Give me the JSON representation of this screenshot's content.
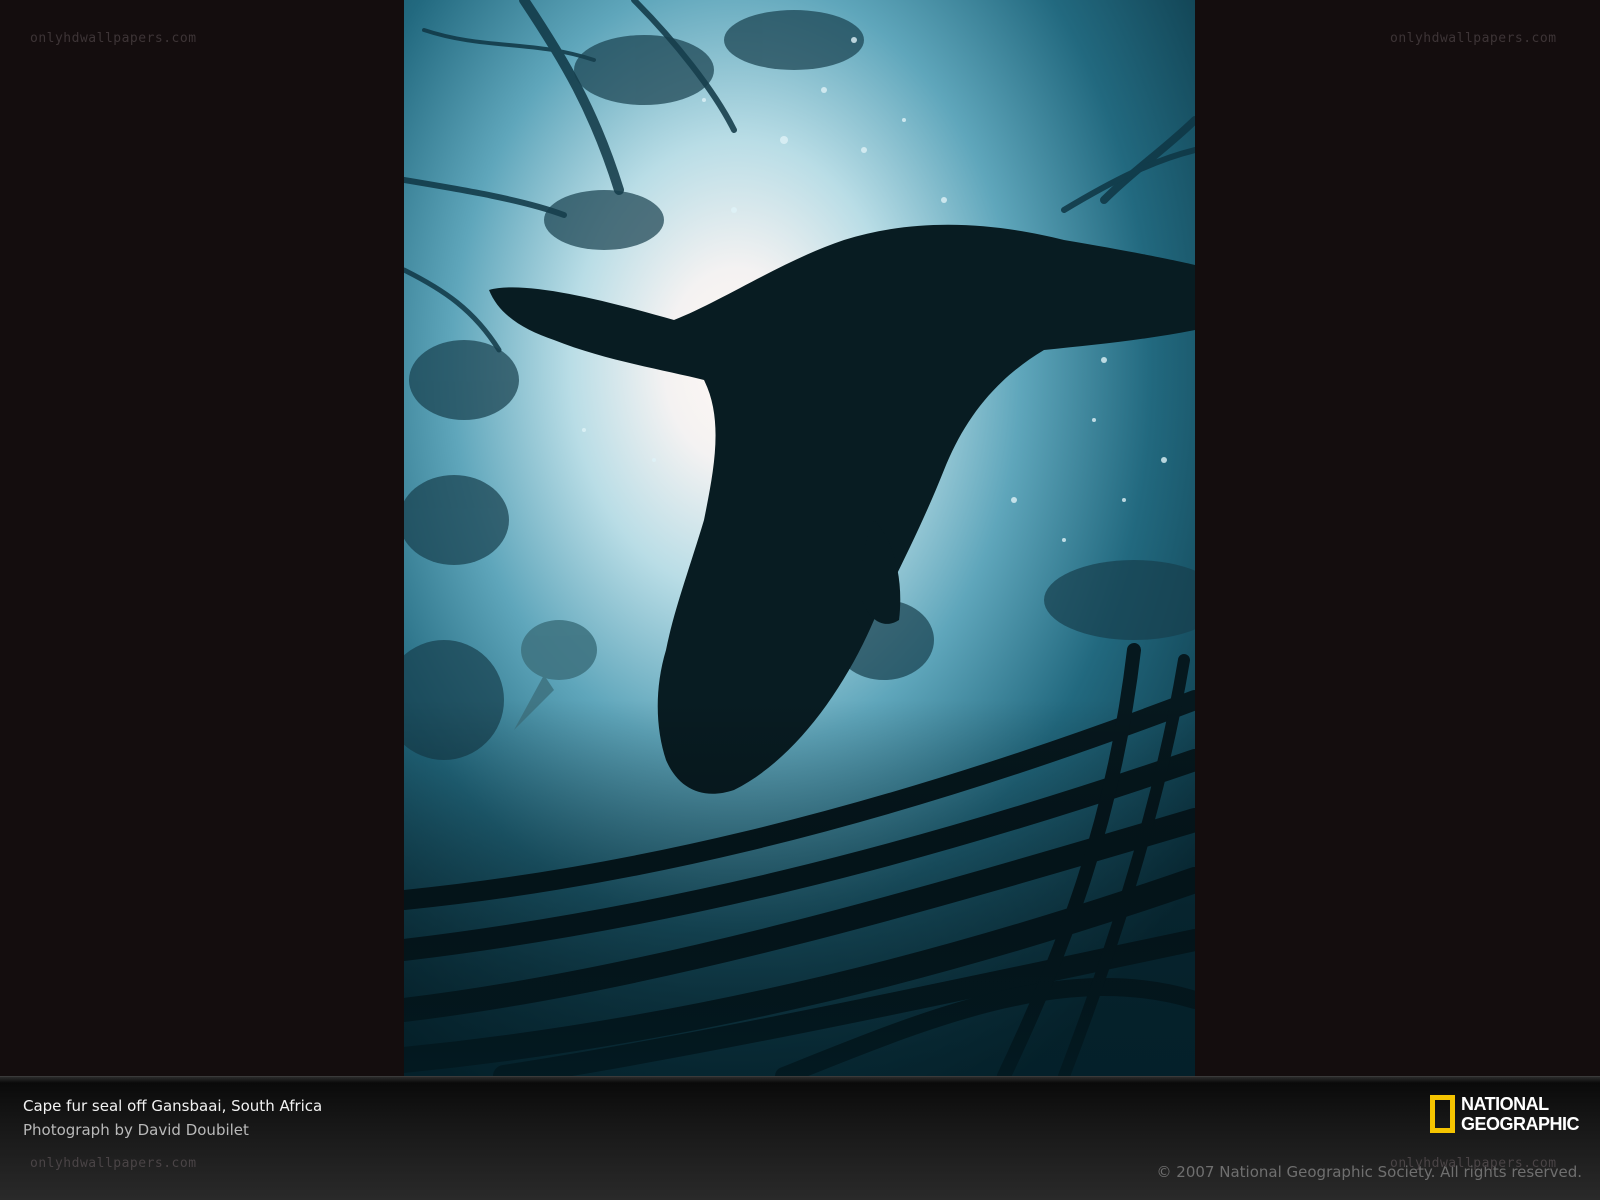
{
  "watermarks": {
    "top_left": "onlyhdwallpapers.com",
    "top_right": "onlyhdwallpapers.com",
    "bottom_left": "onlyhdwallpapers.com",
    "bottom_right": "onlyhdwallpapers.com"
  },
  "caption": {
    "title": "Cape fur seal off Gansbaai, South Africa",
    "credit": "Photograph by David Doubilet",
    "copyright": "© 2007 National Geographic Society. All rights reserved."
  },
  "logo": {
    "line1": "NATIONAL",
    "line2": "GEOGRAPHIC",
    "frame_color": "#f5c400"
  }
}
